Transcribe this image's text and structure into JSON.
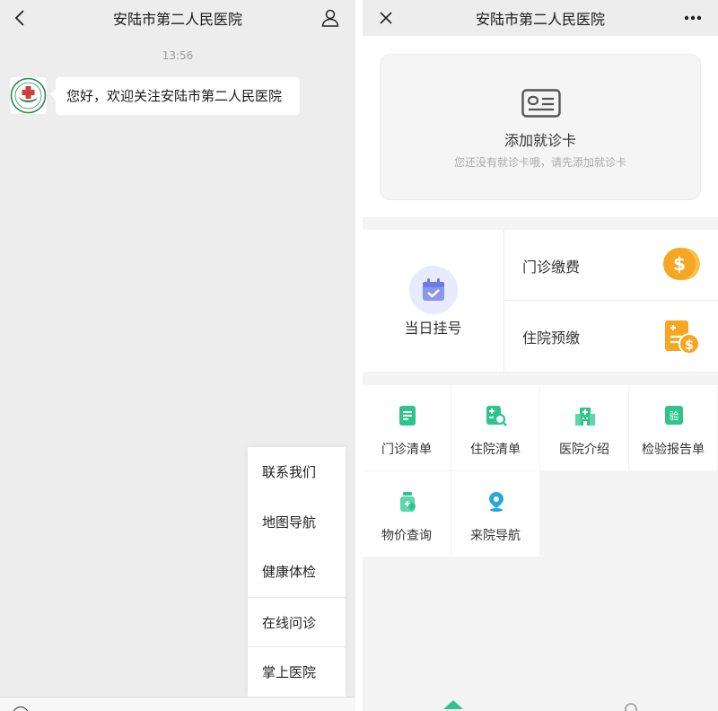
{
  "left": {
    "title": "安陆市第二人民医院",
    "timestamp": "13:56",
    "message": "您好，欢迎关注安陆市第二人民医院",
    "menu": [
      {
        "label": "联系我们"
      },
      {
        "label": "地图导航"
      },
      {
        "label": "健康体检"
      },
      {
        "label": "在线问诊"
      },
      {
        "label": "掌上医院"
      }
    ]
  },
  "right": {
    "title": "安陆市第二人民医院",
    "card": {
      "title": "添加就诊卡",
      "subtitle": "您还没有就诊卡哦，请先添加就诊卡"
    },
    "quick": {
      "register": "当日挂号",
      "outpatient_pay": "门诊缴费",
      "inpatient_prepay": "住院预缴"
    },
    "grid": [
      {
        "label": "门诊清单",
        "icon": "list-doc-icon"
      },
      {
        "label": "住院清单",
        "icon": "list-search-icon"
      },
      {
        "label": "医院介绍",
        "icon": "hospital-building-icon"
      },
      {
        "label": "检验报告单",
        "icon": "lab-report-icon"
      },
      {
        "label": "物价查询",
        "icon": "medicine-bottle-icon"
      },
      {
        "label": "来院导航",
        "icon": "location-pin-icon"
      }
    ],
    "icons": {
      "check": "验"
    }
  },
  "colors": {
    "green": "#2fc38e",
    "orange": "#f5a623",
    "purple": "#7b8ae8",
    "sky": "#25a8e0"
  }
}
